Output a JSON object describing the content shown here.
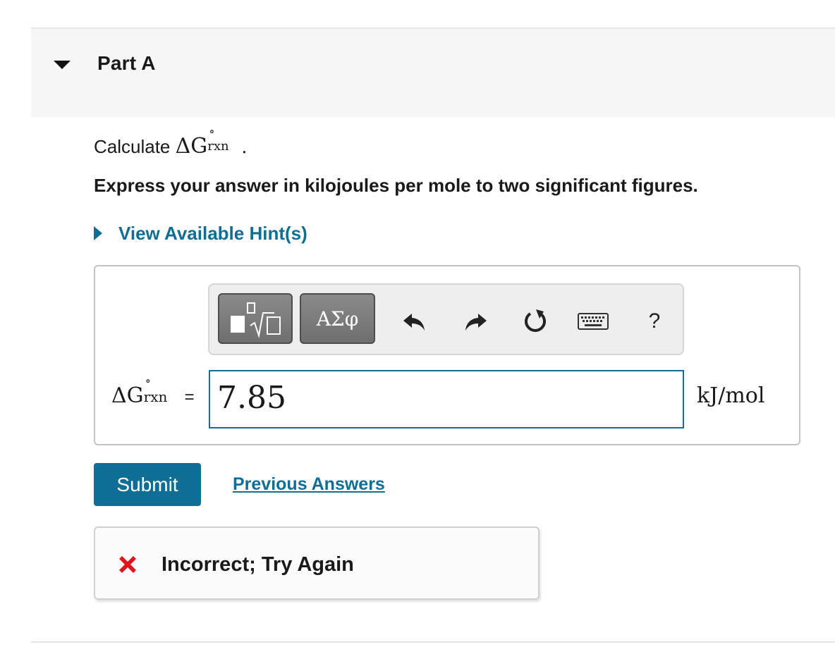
{
  "part": {
    "title": "Part A"
  },
  "question": {
    "prefix": "Calculate",
    "symbol": "ΔG",
    "superscript": "∘",
    "subscript": "rxn",
    "suffix": ".",
    "instruction": "Express your answer in kilojoules per mole to two significant figures."
  },
  "hint": {
    "label": "View Available Hint(s)"
  },
  "toolbar": {
    "templates_icon": "templates-sqrt-icon",
    "greek_label": "ΑΣφ",
    "undo_icon": "undo-icon",
    "redo_icon": "redo-icon",
    "reset_icon": "reset-icon",
    "keyboard_icon": "keyboard-icon",
    "help_label": "?"
  },
  "answer": {
    "label_symbol": "ΔG",
    "label_superscript": "∘",
    "label_subscript": "rxn",
    "equals": "=",
    "value": "7.85",
    "unit": "kJ/mol"
  },
  "actions": {
    "submit_label": "Submit",
    "previous_answers_label": "Previous Answers"
  },
  "feedback": {
    "status": "incorrect",
    "icon": "x-mark-icon",
    "text": "Incorrect; Try Again",
    "icon_color": "#e0141e"
  },
  "colors": {
    "accent": "#0f6e96",
    "header_bg": "#f6f6f6"
  }
}
